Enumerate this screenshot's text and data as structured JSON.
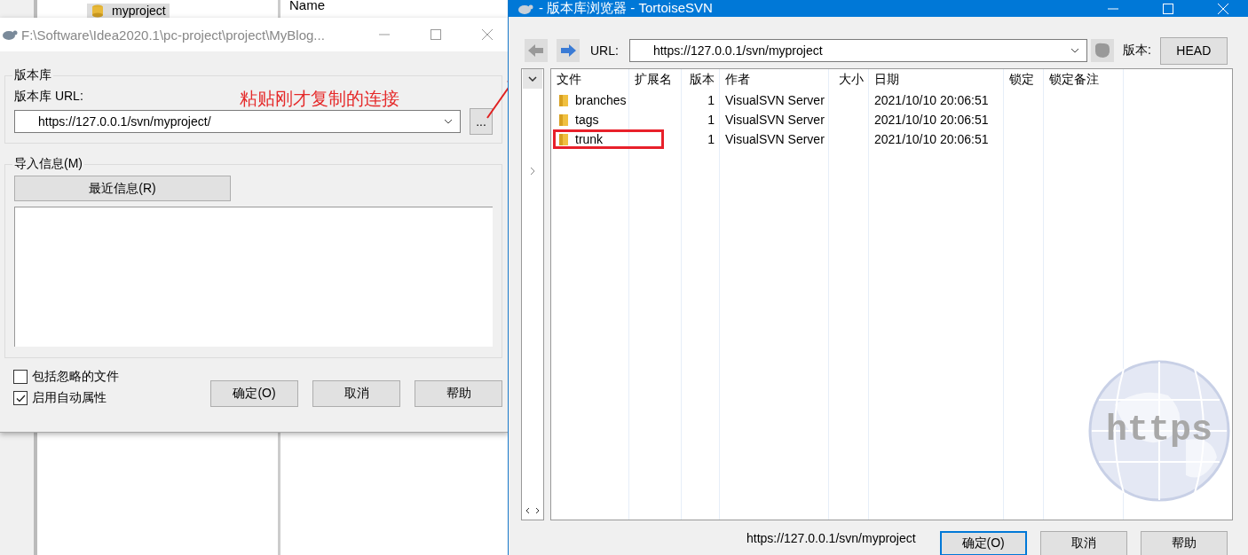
{
  "background_window": {
    "tree_item": "myproject",
    "column_header": "Name"
  },
  "import_dialog": {
    "title": "F:\\Software\\Idea2020.1\\pc-project\\project\\MyBlog...",
    "repository_group": "版本库",
    "url_label": "版本库 URL:",
    "url_value": "https://127.0.0.1/svn/myproject/",
    "browse_button": "...",
    "message_group": "导入信息(M)",
    "recent_button": "最近信息(R)",
    "options": [
      {
        "label": "包括忽略的文件",
        "checked": false
      },
      {
        "label": "启用自动属性",
        "checked": true
      }
    ],
    "buttons": [
      "确定(O)",
      "取消",
      "帮助"
    ]
  },
  "annotation": {
    "text": "粘贴刚才复制的连接"
  },
  "repo_browser": {
    "title": "- 版本库浏览器 - TortoiseSVN",
    "url_label": "URL:",
    "url_value": "https://127.0.0.1/svn/myproject",
    "revision_label": "版本:",
    "revision_button": "HEAD",
    "columns": [
      "文件",
      "扩展名",
      "版本",
      "作者",
      "大小",
      "日期",
      "锁定",
      "锁定备注"
    ],
    "rows": [
      {
        "name": "branches",
        "revision": "1",
        "author": "VisualSVN Server",
        "date": "2021/10/10 20:06:51",
        "highlighted": false
      },
      {
        "name": "tags",
        "revision": "1",
        "author": "VisualSVN Server",
        "date": "2021/10/10 20:06:51",
        "highlighted": false
      },
      {
        "name": "trunk",
        "revision": "1",
        "author": "VisualSVN Server",
        "date": "2021/10/10 20:06:51",
        "highlighted": true
      }
    ],
    "globe_text": "https",
    "status_url": "https://127.0.0.1/svn/myproject",
    "buttons": [
      "确定(O)",
      "取消",
      "帮助"
    ]
  }
}
